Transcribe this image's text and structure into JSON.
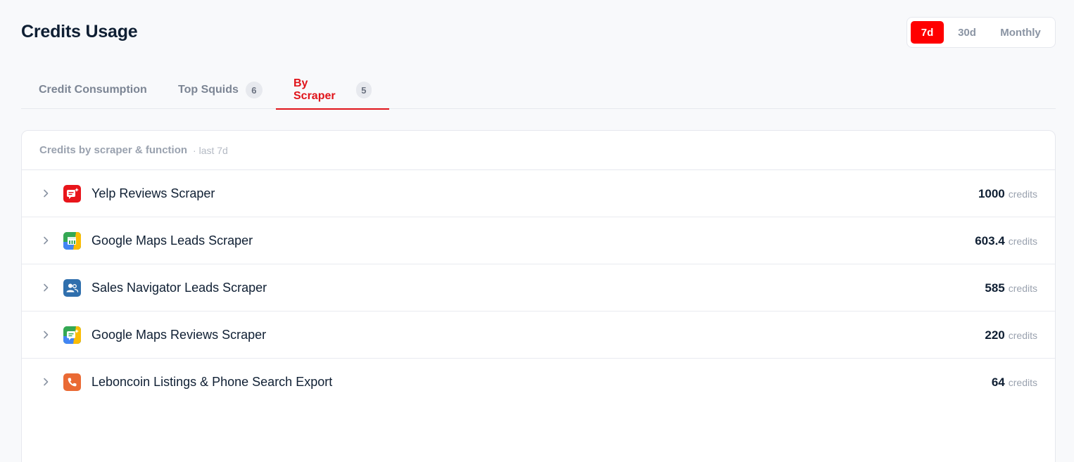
{
  "page": {
    "title": "Credits Usage"
  },
  "range": {
    "options": [
      "7d",
      "30d",
      "Monthly"
    ],
    "selected": "7d",
    "accent": "#ff0000"
  },
  "tabs": [
    {
      "label": "Credit Consumption",
      "count": null
    },
    {
      "label": "Top Squids",
      "count": "6"
    },
    {
      "label": "By Scraper",
      "count": "5",
      "active": true
    }
  ],
  "card": {
    "title": "Credits by scraper & function",
    "subtitle": "· last 7d",
    "unit_label": "credits",
    "rows": [
      {
        "name": "Yelp Reviews Scraper",
        "value": "1000",
        "icon": "yelp-reviews-icon",
        "color": "#e8151b"
      },
      {
        "name": "Google Maps Leads Scraper",
        "value": "603.4",
        "icon": "google-maps-store-icon",
        "color": "#34a853"
      },
      {
        "name": "Sales Navigator Leads Scraper",
        "value": "585",
        "icon": "users-icon",
        "color": "#2f6fad"
      },
      {
        "name": "Google Maps Reviews Scraper",
        "value": "220",
        "icon": "google-maps-reviews-icon",
        "color": "#34a853"
      },
      {
        "name": "Leboncoin Listings & Phone Search Export",
        "value": "64",
        "icon": "phone-icon",
        "color": "#ea6a34"
      }
    ]
  }
}
